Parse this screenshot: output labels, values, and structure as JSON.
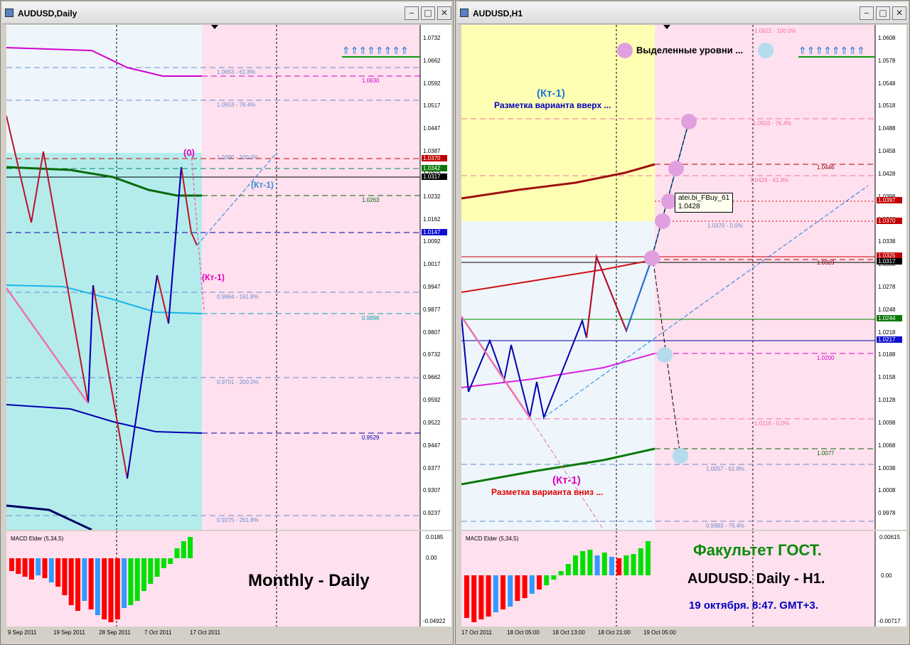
{
  "left": {
    "title": "AUDUSD,Daily",
    "price_axis": [
      "1.0732",
      "1.0662",
      "1.0592",
      "1.0517",
      "1.0447",
      "1.0387",
      "1.0302",
      "1.0232",
      "1.0162",
      "1.0092",
      "1.0017",
      "0.9947",
      "0.9877",
      "0.9807",
      "0.9732",
      "0.9662",
      "0.9592",
      "0.9522",
      "0.9447",
      "0.9377",
      "0.9307",
      "0.9237"
    ],
    "price_tags": [
      "1.0370",
      "1.0342",
      "1.0317",
      "1.0147"
    ],
    "fibo_labels": [
      "1.0653 - 61.8%",
      "1.0553 - 76.4%",
      "1.0390 - 100.0%",
      "0.9964 - 161.8%",
      "0.9701 - 200.0%",
      "0.9275 - 261.8%"
    ],
    "level_labels": [
      "1.0630",
      "1.0263",
      "0.9896",
      "0.9529"
    ],
    "annotations": {
      "zero": "(0)",
      "kt1_up": "(Кт-1)",
      "kt1_down": "(Кт-1)"
    },
    "arrows": "⇑⇑⇑⇑⇑⇑⇑⇑",
    "macd_label": "MACD Elder (5,34,5)",
    "macd_axis": [
      "0.0185",
      "0.00",
      "-0.04922"
    ],
    "overlay_text": "Monthly - Daily",
    "time_axis": [
      "9 Sep 2011",
      "19 Sep 2011",
      "28 Sep 2011",
      "7 Oct 2011",
      "17 Oct 2011"
    ]
  },
  "right": {
    "title": "AUDUSD,H1",
    "price_axis": [
      "1.0608",
      "1.0578",
      "1.0548",
      "1.0518",
      "1.0488",
      "1.0458",
      "1.0428",
      "1.0398",
      "1.0368",
      "1.0338",
      "1.0308",
      "1.0278",
      "1.0248",
      "1.0218",
      "1.0188",
      "1.0158",
      "1.0128",
      "1.0098",
      "1.0068",
      "1.0038",
      "1.0008",
      "0.9978"
    ],
    "price_tags": [
      "1.0397",
      "1.0370",
      "1.0325",
      "1.0317",
      "1.0244",
      "1.0217"
    ],
    "fibo_labels": [
      "1.0622 - 100.0%",
      "1.0503 - 76.4%",
      "1.0429 - 61.8%",
      "1.0370 - 0.0%",
      "1.0116 - 0.0%",
      "1.0057 - 61.8%",
      "0.9983 - 76.4%"
    ],
    "level_labels": [
      "1.0446",
      "1.0323",
      "1.0200",
      "1.0077"
    ],
    "headline": "Выделенные уровни ...",
    "kt1_up": "(Кт-1)",
    "up_caption": "Разметка варианта вверх ...",
    "kt1_down": "(Кт-1)",
    "down_caption": "Разметка варианта вниз ...",
    "tooltip": {
      "name": "atei.bi_FBuy_61",
      "value": "1.0428"
    },
    "arrows": "⇑⇑⇑⇑⇑⇑⇑⇑",
    "macd_label": "MACD Elder (5,34,5)",
    "macd_axis": [
      "0.00615",
      "0.00",
      "-0.00717"
    ],
    "faculty": "Факультет ГОСТ.",
    "pair_text": "AUDUSD. Daily - H1.",
    "date_text": "19 октября. 8:47. GMT+3.",
    "time_axis": [
      "17 Oct 2011",
      "18 Oct 05:00",
      "18 Oct 13:00",
      "18 Oct 21:00",
      "19 Oct 05:00"
    ]
  },
  "colors": {
    "pink_bg": "#ffe0ee",
    "cyan_bg": "#b4ecec",
    "yellow_bg": "#ffffb4",
    "pale_bg": "#eef6fb"
  }
}
